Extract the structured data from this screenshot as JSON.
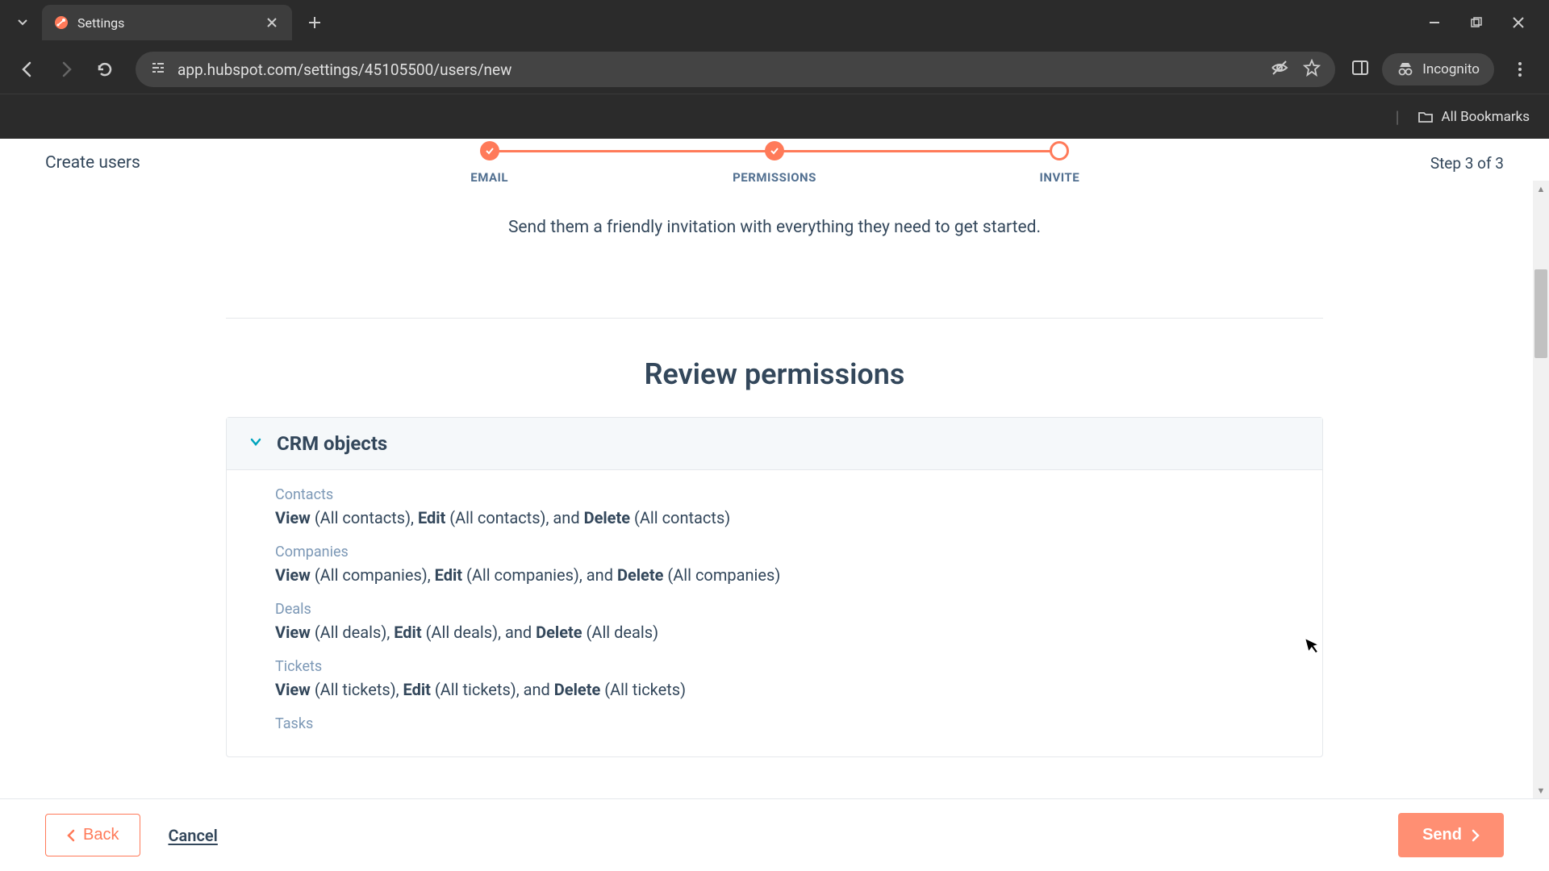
{
  "browser": {
    "tab_title": "Settings",
    "url": "app.hubspot.com/settings/45105500/users/new",
    "incognito_label": "Incognito",
    "all_bookmarks_label": "All Bookmarks"
  },
  "wizard": {
    "title": "Create users",
    "step_text": "Step 3 of 3",
    "steps": {
      "email": "EMAIL",
      "permissions": "PERMISSIONS",
      "invite": "INVITE"
    }
  },
  "content": {
    "subtitle": "Send them a friendly invitation with everything they need to get started.",
    "section_title": "Review permissions",
    "panel_title": "CRM objects",
    "permissions": {
      "contacts": {
        "title": "Contacts",
        "view_label": "View",
        "view_scope": " (All contacts), ",
        "edit_label": "Edit",
        "edit_scope": " (All contacts), and ",
        "delete_label": "Delete",
        "delete_scope": " (All contacts)"
      },
      "companies": {
        "title": "Companies",
        "view_label": "View",
        "view_scope": " (All companies), ",
        "edit_label": "Edit",
        "edit_scope": " (All companies), and ",
        "delete_label": "Delete",
        "delete_scope": " (All companies)"
      },
      "deals": {
        "title": "Deals",
        "view_label": "View",
        "view_scope": " (All deals), ",
        "edit_label": "Edit",
        "edit_scope": " (All deals), and ",
        "delete_label": "Delete",
        "delete_scope": " (All deals)"
      },
      "tickets": {
        "title": "Tickets",
        "view_label": "View",
        "view_scope": " (All tickets), ",
        "edit_label": "Edit",
        "edit_scope": " (All tickets), and ",
        "delete_label": "Delete",
        "delete_scope": " (All tickets)"
      },
      "tasks": {
        "title": "Tasks"
      }
    }
  },
  "footer": {
    "back_label": "Back",
    "cancel_label": "Cancel",
    "send_label": "Send"
  },
  "colors": {
    "accent": "#ff7a59",
    "text_primary": "#33475b",
    "text_muted": "#7c98b6",
    "link": "#00a4bd"
  }
}
